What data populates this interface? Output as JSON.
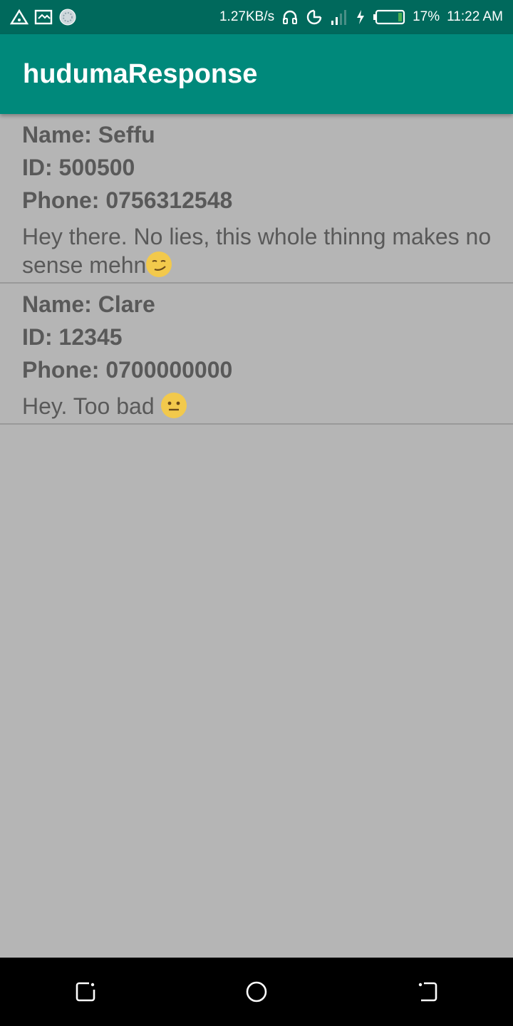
{
  "status_bar": {
    "net_speed": "1.27KB/s",
    "battery": "17%",
    "time": "11:22 AM",
    "icons": [
      "alert-triangle-icon",
      "screen-cast-icon",
      "app-notification-icon",
      "headphones-icon",
      "data-saver-icon",
      "signal-icon",
      "charging-icon",
      "battery-icon"
    ]
  },
  "app_bar": {
    "title": "hudumaResponse"
  },
  "responses": [
    {
      "name": "Name: Seffu",
      "id": "ID: 500500",
      "phone": "Phone: 0756312548",
      "message": "Hey there.  No lies,  this whole thinng makes no sense mehn",
      "emoji": "smirking-face-emoji"
    },
    {
      "name": "Name: Clare",
      "id": "ID: 12345",
      "phone": "Phone: 0700000000",
      "message": "Hey. Too bad ",
      "emoji": "neutral-face-emoji"
    }
  ],
  "nav_bar": {
    "icons": [
      "recent-apps-icon",
      "home-icon",
      "back-icon"
    ]
  }
}
